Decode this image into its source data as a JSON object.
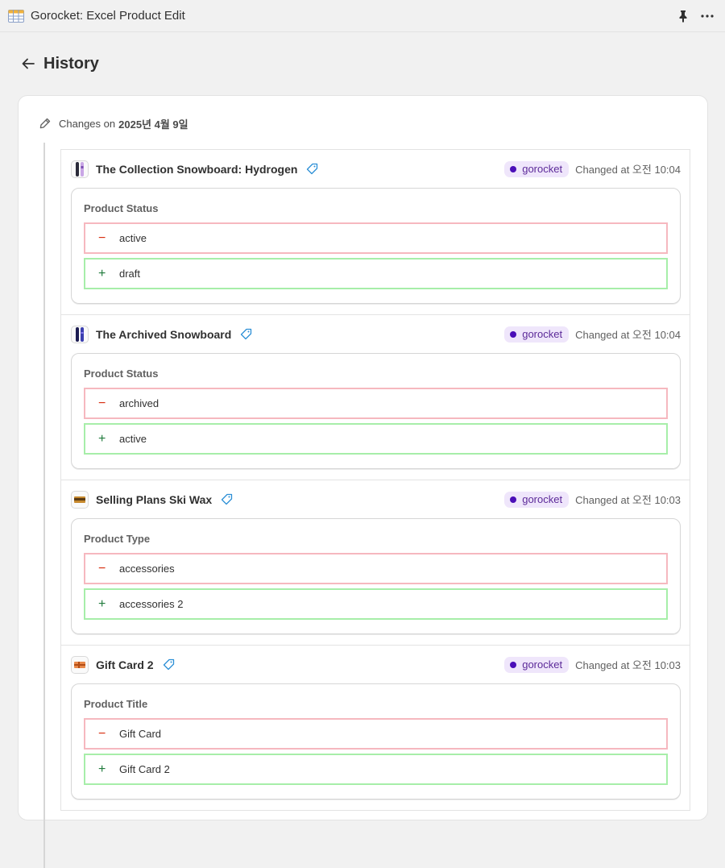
{
  "app": {
    "title": "Gorocket: Excel Product Edit",
    "icon": "spreadsheet-icon"
  },
  "header": {
    "title": "History",
    "back_icon": "arrow-left-icon"
  },
  "changes": {
    "prefix": "Changes on",
    "date": "2025년 4월 9일"
  },
  "entries": [
    {
      "name": "The Collection Snowboard: Hydrogen",
      "user": "gorocket",
      "changed_at": "Changed at 오전 10:04",
      "field": "Product Status",
      "old": "active",
      "new": "draft"
    },
    {
      "name": "The Archived Snowboard",
      "user": "gorocket",
      "changed_at": "Changed at 오전 10:04",
      "field": "Product Status",
      "old": "archived",
      "new": "active"
    },
    {
      "name": "Selling Plans Ski Wax",
      "user": "gorocket",
      "changed_at": "Changed at 오전 10:03",
      "field": "Product Type",
      "old": "accessories",
      "new": "accessories 2"
    },
    {
      "name": "Gift Card 2",
      "user": "gorocket",
      "changed_at": "Changed at 오전 10:03",
      "field": "Product Title",
      "old": "Gift Card",
      "new": "Gift Card 2"
    }
  ],
  "signs": {
    "removed": "−",
    "added": "+"
  },
  "colors": {
    "badge_bg": "#efe6fb",
    "badge_dot": "#4b0fb8",
    "removed_border": "#f6b8bf",
    "added_border": "#a7eea9"
  }
}
